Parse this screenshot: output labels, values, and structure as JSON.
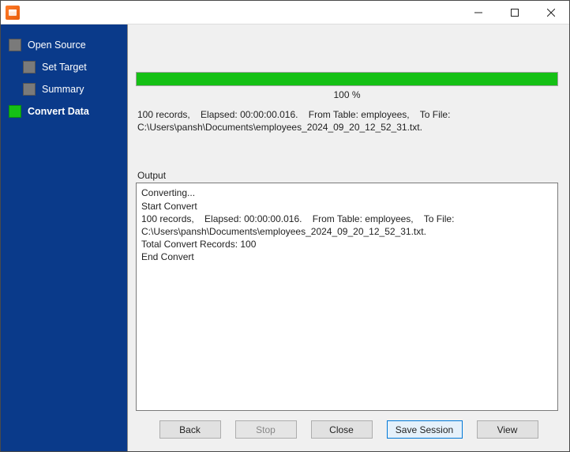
{
  "titlebar": {
    "title": ""
  },
  "sidebar": {
    "steps": [
      {
        "label": "Open Source",
        "sub": false,
        "active": false
      },
      {
        "label": "Set Target",
        "sub": true,
        "active": false
      },
      {
        "label": "Summary",
        "sub": true,
        "active": false
      },
      {
        "label": "Convert Data",
        "sub": false,
        "active": true
      }
    ]
  },
  "progress": {
    "percent_label": "100 %",
    "bar_fill_color": "#15c015"
  },
  "summary_text": "100 records,    Elapsed: 00:00:00.016.    From Table: employees,    To File: C:\\Users\\pansh\\Documents\\employees_2024_09_20_12_52_31.txt.",
  "output": {
    "label": "Output",
    "text": "Converting...\nStart Convert\n100 records,    Elapsed: 00:00:00.016.    From Table: employees,    To File: C:\\Users\\pansh\\Documents\\employees_2024_09_20_12_52_31.txt.\nTotal Convert Records:: 100\nEnd Convert"
  },
  "output_fixed_text": "Converting...\nStart Convert\n100 records,    Elapsed: 00:00:00.016.    From Table: employees,    To File: C:\\Users\\pansh\\Documents\\employees_2024_09_20_12_52_31.txt.\nTotal Convert Records: 100\nEnd Convert",
  "buttons": {
    "back": "Back",
    "stop": "Stop",
    "close": "Close",
    "save_session": "Save Session",
    "view": "View"
  }
}
